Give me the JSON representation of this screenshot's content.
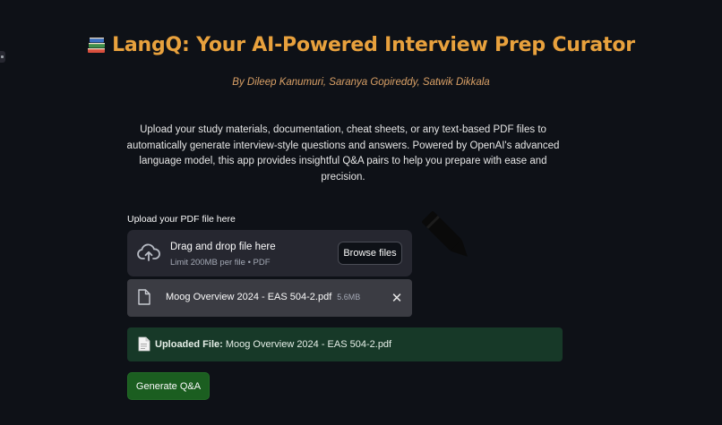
{
  "header": {
    "title": "LangQ: Your AI-Powered Interview Prep Curator",
    "authors": "By Dileep Kanumuri, Saranya Gopireddy, Satwik Dikkala",
    "title_icon": "books-icon"
  },
  "description": "Upload your study materials, documentation, cheat sheets, or any text-based PDF files to automatically generate interview-style questions and answers. Powered by OpenAI's advanced language model, this app provides insightful Q&A pairs to help you prepare with ease and precision.",
  "uploader": {
    "label": "Upload your PDF file here",
    "drop_title": "Drag and drop file here",
    "drop_limit": "Limit 200MB per file • PDF",
    "browse_label": "Browse files",
    "icons": {
      "dropzone": "cloud-upload-icon",
      "file": "file-icon",
      "remove": "close-icon",
      "decoration": "pencil-icon"
    }
  },
  "uploaded_file": {
    "name": "Moog Overview 2024 - EAS 504-2.pdf",
    "size": "5.6MB",
    "close_glyph": "✕"
  },
  "success": {
    "label": "Uploaded File:",
    "value": "Moog Overview 2024 - EAS 504-2.pdf"
  },
  "actions": {
    "generate_label": "Generate Q&A"
  },
  "colors": {
    "background": "#0e1117",
    "title": "#e8a13d",
    "authors": "#d9a066",
    "success_bg": "#173928",
    "primary_button": "#1b5e20"
  }
}
